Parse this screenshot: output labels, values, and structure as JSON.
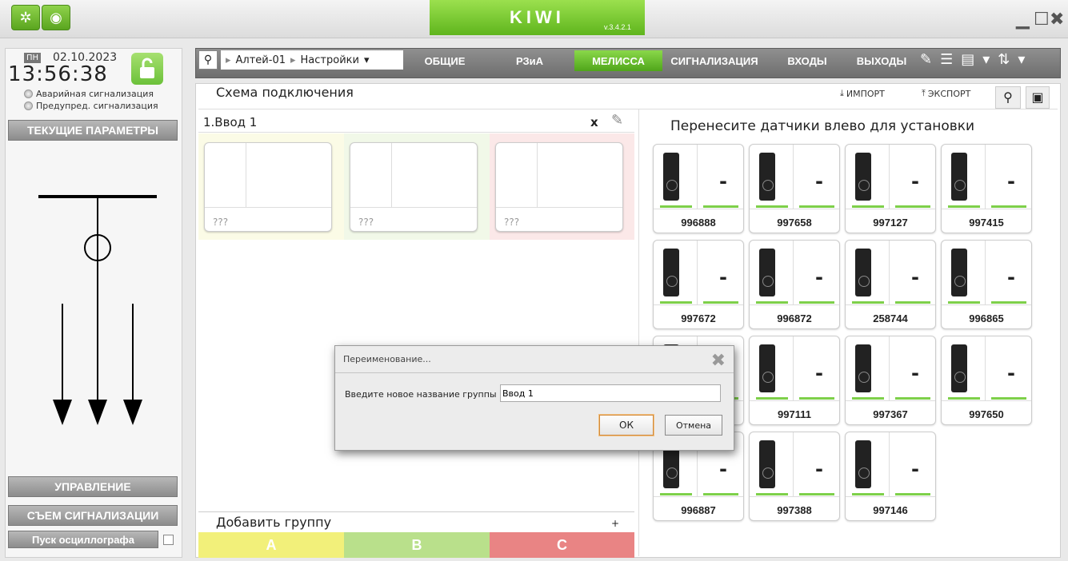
{
  "titlebar": {
    "app_name": "KIWI",
    "version": "v.3.4.2.1"
  },
  "clock": {
    "day": "ПН",
    "date": "02.10.2023",
    "time": "13:56:38"
  },
  "alarms": {
    "emergency": "Аварийная сигнализация",
    "warning": "Предупред. сигнализация"
  },
  "left": {
    "current_params": "ТЕКУЩИЕ ПАРАМЕТРЫ",
    "control": "УПРАВЛЕНИЕ",
    "reset_alarm": "СЪЕМ СИГНАЛИЗАЦИИ",
    "osc_start": "Пуск осциллографа"
  },
  "nav": {
    "crumb1": "Алтей-01",
    "crumb2": "Настройки",
    "tabs": [
      "ОБЩИЕ",
      "РЗиА",
      "МЕЛИССА",
      "СИГНАЛИЗАЦИЯ",
      "ВХОДЫ",
      "ВЫХОДЫ"
    ],
    "active_tab": "МЕЛИССА"
  },
  "panel": {
    "title": "Схема подключения",
    "import": "ИМПОРТ",
    "export": "ЭКСПОРТ"
  },
  "group": {
    "name": "1.Ввод 1",
    "close": "x",
    "slots": [
      "???",
      "???",
      "???"
    ],
    "add_label": "Добавить группу",
    "add_plus": "+",
    "phases": [
      "A",
      "B",
      "C"
    ]
  },
  "available": {
    "header": "Перенесите датчики влево для установки",
    "sensors": [
      {
        "id": "996888",
        "value": "-"
      },
      {
        "id": "997658",
        "value": "-"
      },
      {
        "id": "997127",
        "value": "-"
      },
      {
        "id": "997415",
        "value": "-"
      },
      {
        "id": "997672",
        "value": "-"
      },
      {
        "id": "996872",
        "value": "-"
      },
      {
        "id": "258744",
        "value": "-"
      },
      {
        "id": "996865",
        "value": "-"
      },
      {
        "id": "",
        "value": ""
      },
      {
        "id": "997111",
        "value": "-"
      },
      {
        "id": "997367",
        "value": "-"
      },
      {
        "id": "997650",
        "value": "-"
      },
      {
        "id": "996887",
        "value": "-"
      },
      {
        "id": "997388",
        "value": "-"
      },
      {
        "id": "997146",
        "value": "-"
      }
    ]
  },
  "dialog": {
    "title": "Переименование...",
    "label": "Введите новое название группы",
    "value": "Ввод 1",
    "ok": "ОК",
    "cancel": "Отмена"
  },
  "colors": {
    "accent": "#6cc13a",
    "phase_a": "#f2f07a",
    "phase_b": "#b9e08b",
    "phase_c": "#e98484"
  }
}
